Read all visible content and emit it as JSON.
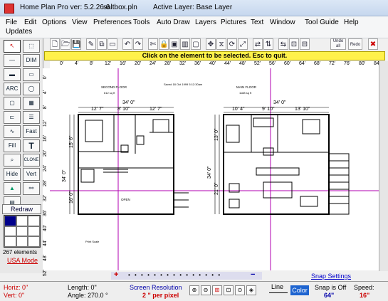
{
  "titlebar": {
    "app": "Home Plan Pro ver: 5.2.26.6",
    "file": "saltbox.pln",
    "layer": "Active Layer: Base Layer"
  },
  "menu": {
    "file": "File",
    "edit": "Edit",
    "options": "Options",
    "view": "View",
    "preferences": "Preferences",
    "tools": "Tools",
    "auto_draw": "Auto Draw",
    "layers": "Layers",
    "pictures": "Pictures",
    "text": "Text",
    "window": "Window",
    "tool_guide": "Tool Guide",
    "help": "Help",
    "updates": "Updates"
  },
  "toolbar": {
    "grp1": [
      "🗋",
      "🗁",
      "💾",
      "✎",
      "⧉",
      "▭",
      "↶",
      "↷",
      "✄",
      "🔒",
      "▣",
      "▥",
      "▢"
    ],
    "grp2": [
      "✥",
      "⧖",
      "⟳",
      "⤢",
      "⇄",
      "⇅",
      "⇆",
      "⊡",
      "⊟"
    ],
    "undo_label": "Undo all",
    "redo_label": "Redo"
  },
  "prompt": "Click on the element to be selected.  Esc to quit.",
  "ruler": {
    "top_ticks": [
      "0'",
      "4'",
      "8'",
      "12'",
      "16'",
      "20'",
      "24'",
      "28'",
      "32'",
      "36'",
      "40'",
      "44'",
      "48'",
      "52'",
      "56'",
      "60'",
      "64'",
      "68'",
      "72'",
      "76'",
      "80'",
      "84'"
    ],
    "left_ticks": [
      "0'",
      "4'",
      "8'",
      "12'",
      "16'",
      "20'",
      "24'",
      "28'",
      "32'",
      "36'",
      "40'",
      "44'",
      "48'",
      "52'"
    ]
  },
  "tools": {
    "dim": "DIM",
    "arc": "ARC",
    "fast": "Fast",
    "fill": "Fill",
    "clone": "CLONE",
    "hide": "Hide",
    "vert": "Vert",
    "redraw": "Redraw"
  },
  "left_status": {
    "elements": "267 elements",
    "usa_mode": "USA Mode"
  },
  "plan": {
    "second_floor": "SECOND FLOOR",
    "second_area": "612 sq ft",
    "saved": "Saved  18 Oct 1999  5:12:30am",
    "main_floor": "MAIN FLOOR",
    "main_area": "1188 sq ft",
    "open": "OPEN",
    "scale": "Print Scale",
    "dim_34_top_left": "34' 0\"",
    "dim_12_7_a": "12' 7\"",
    "dim_8_10": "8' 10\"",
    "dim_12_7_b": "12' 7\"",
    "dim_34_top_right": "34' 0\"",
    "dim_10_4": "10' 4\"",
    "dim_9_10": "9' 10\"",
    "dim_13_10": "13' 10\"",
    "dim_34_left": "34' 0\"",
    "dim_15_6": "15' 6\"",
    "dim_16_0": "16' 0\"",
    "dim_34_right": "34' 0\"",
    "dim_13_0": "13' 0\"",
    "dim_21_0": "21' 0\""
  },
  "snap_settings": "Snap Settings",
  "status": {
    "horiz": "Horiz: 0\"",
    "vert": "Vert: 0\"",
    "length": "Length: 0\"",
    "angle": "Angle: 270.0 °",
    "screen_res_label": "Screen Resolution",
    "screen_res_value": "2 \" per pixel",
    "line_label": "Line",
    "color_label": "Color",
    "snap_label": "Snap is Off",
    "snap_value": "64\"",
    "speed_label": "Speed:",
    "speed_value": "16\""
  },
  "colors": {
    "prompt_bg": "#fff14a",
    "accent_magenta": "#b000b0",
    "color_button": "#1e64d0",
    "usa_mode": "#cc0000"
  }
}
